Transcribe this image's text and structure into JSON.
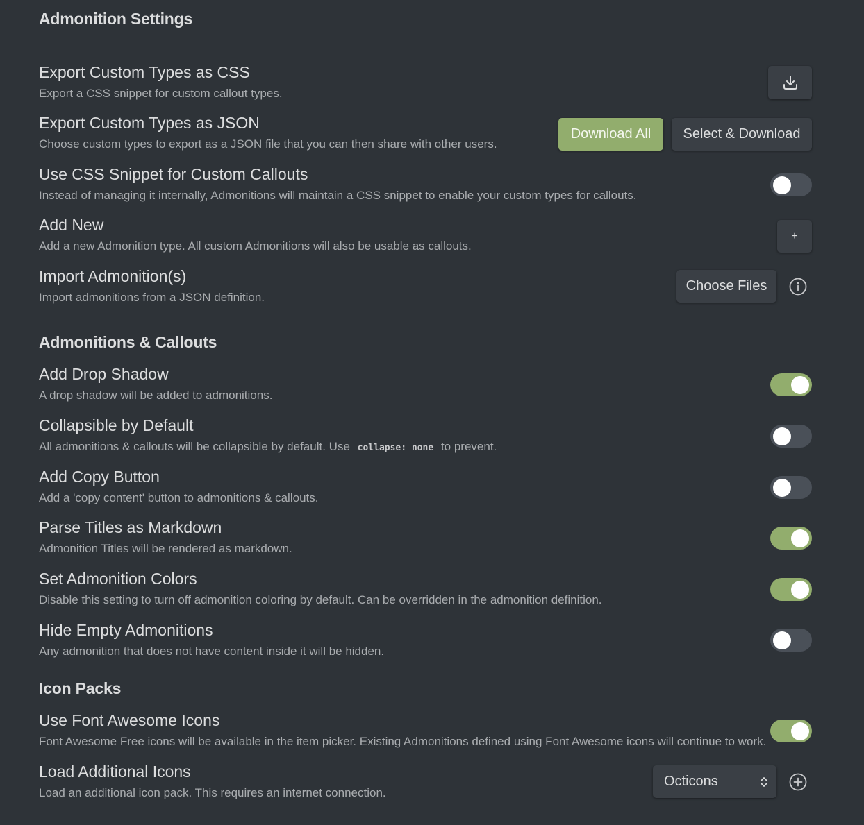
{
  "page": {
    "title": "Admonition Settings"
  },
  "settings": {
    "export_css": {
      "name": "Export Custom Types as CSS",
      "desc": "Export a CSS snippet for custom callout types.",
      "button_icon": "download-icon"
    },
    "export_json": {
      "name": "Export Custom Types as JSON",
      "desc": "Choose custom types to export as a JSON file that you can then share with other users.",
      "download_all_label": "Download All",
      "select_download_label": "Select & Download"
    },
    "css_snippet": {
      "name": "Use CSS Snippet for Custom Callouts",
      "desc": "Instead of managing it internally, Admonitions will maintain a CSS snippet to enable your custom types for callouts.",
      "enabled": false
    },
    "add_new": {
      "name": "Add New",
      "desc": "Add a new Admonition type. All custom Admonitions will also be usable as callouts.",
      "button_label": "+"
    },
    "import": {
      "name": "Import Admonition(s)",
      "desc": "Import admonitions from a JSON definition.",
      "button_label": "Choose Files",
      "info_icon": "info-icon"
    }
  },
  "sections": {
    "admonitions_callouts": {
      "heading": "Admonitions & Callouts",
      "items": {
        "drop_shadow": {
          "name": "Add Drop Shadow",
          "desc": "A drop shadow will be added to admonitions.",
          "enabled": true
        },
        "collapsible": {
          "name": "Collapsible by Default",
          "desc_before": "All admonitions & callouts will be collapsible by default. Use",
          "desc_code": "collapse: none",
          "desc_after": "to prevent.",
          "enabled": false
        },
        "copy_button": {
          "name": "Add Copy Button",
          "desc": "Add a 'copy content' button to admonitions & callouts.",
          "enabled": false
        },
        "parse_titles": {
          "name": "Parse Titles as Markdown",
          "desc": "Admonition Titles will be rendered as markdown.",
          "enabled": true
        },
        "colors": {
          "name": "Set Admonition Colors",
          "desc": "Disable this setting to turn off admonition coloring by default. Can be overridden in the admonition definition.",
          "enabled": true
        },
        "hide_empty": {
          "name": "Hide Empty Admonitions",
          "desc": "Any admonition that does not have content inside it will be hidden.",
          "enabled": false
        }
      }
    },
    "icon_packs": {
      "heading": "Icon Packs",
      "items": {
        "font_awesome": {
          "name": "Use Font Awesome Icons",
          "desc": "Font Awesome Free icons will be available in the item picker. Existing Admonitions defined using Font Awesome icons will continue to work.",
          "enabled": true
        },
        "additional": {
          "name": "Load Additional Icons",
          "desc": "Load an additional icon pack. This requires an internet connection.",
          "selected": "Octicons",
          "add_icon": "plus-circle-icon"
        }
      }
    }
  },
  "colors": {
    "background": "#2e3338",
    "accent": "#92ad6d",
    "button": "#3a3f45",
    "toggle_off": "#4a5058"
  }
}
